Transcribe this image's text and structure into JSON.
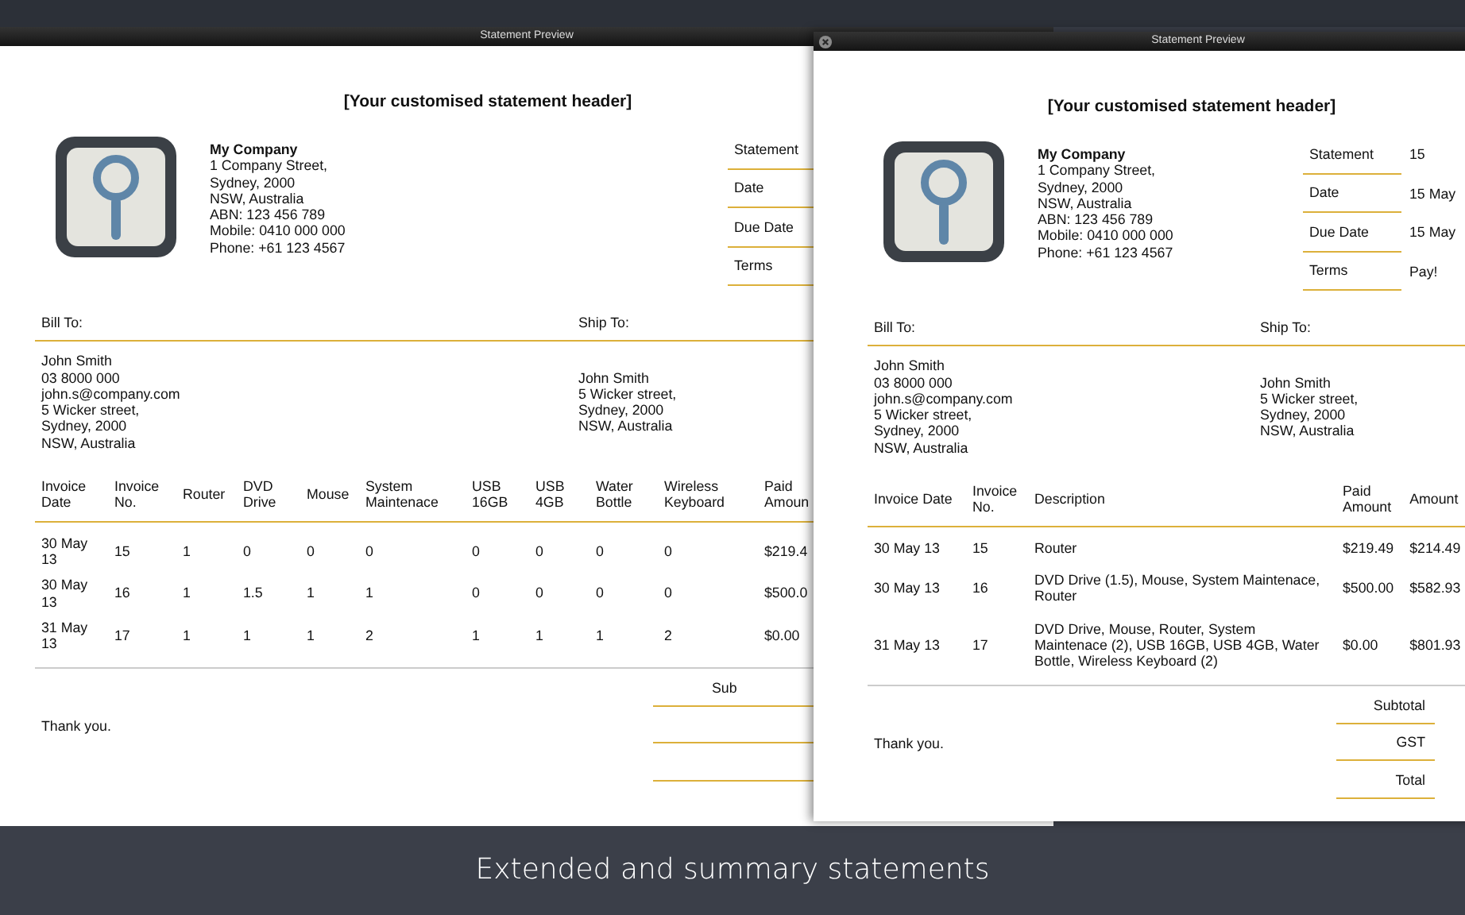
{
  "windows": [
    {
      "kind": "extended",
      "title": "Statement Preview",
      "closable": false,
      "header": "[Your customised statement header]",
      "company": {
        "name": "My Company",
        "lines": [
          "1 Company Street,",
          "Sydney, 2000",
          "NSW, Australia",
          "ABN: 123 456 789",
          "Mobile: 0410 000 000",
          "Phone: +61 123 4567"
        ]
      },
      "meta": [
        {
          "label": "Statement"
        },
        {
          "label": "Date"
        },
        {
          "label": "Due Date"
        },
        {
          "label": "Terms"
        }
      ],
      "bill_to_label": "Bill To:",
      "ship_to_label": "Ship To:",
      "bill_to": [
        "John Smith",
        "03 8000 000",
        "john.s@company.com",
        "5 Wicker street,",
        "Sydney, 2000",
        "NSW, Australia"
      ],
      "ship_to": [
        "John Smith",
        "5 Wicker street,",
        "Sydney, 2000",
        "NSW, Australia"
      ],
      "table": {
        "columns": [
          "Invoice Date",
          "Invoice No.",
          "Router",
          "DVD Drive",
          "Mouse",
          "System Maintenace",
          "USB 16GB",
          "USB 4GB",
          "Water Bottle",
          "Wireless Keyboard",
          "Paid Amoun"
        ],
        "rows": [
          [
            "30 May 13",
            "15",
            "1",
            "0",
            "0",
            "0",
            "0",
            "0",
            "0",
            "0",
            "$219.4"
          ],
          [
            "30 May 13",
            "16",
            "1",
            "1.5",
            "1",
            "1",
            "0",
            "0",
            "0",
            "0",
            "$500.0"
          ],
          [
            "31 May 13",
            "17",
            "1",
            "1",
            "1",
            "2",
            "1",
            "1",
            "1",
            "2",
            "$0.00"
          ]
        ]
      },
      "thank_you": "Thank you.",
      "totals": [
        {
          "label": "Sub",
          "ruled": true
        },
        {
          "ruled": true
        },
        {
          "ruled": true
        }
      ]
    },
    {
      "kind": "summary",
      "title": "Statement Preview",
      "closable": true,
      "header": "[Your customised statement header]",
      "company": {
        "name": "My Company",
        "lines": [
          "1 Company Street,",
          "Sydney, 2000",
          "NSW, Australia",
          "ABN: 123 456 789",
          "Mobile: 0410 000 000",
          "Phone: +61 123 4567"
        ]
      },
      "meta": [
        {
          "label": "Statement",
          "value": "15"
        },
        {
          "label": "Date",
          "value": "15 May"
        },
        {
          "label": "Due Date",
          "value": "15 May"
        },
        {
          "label": "Terms",
          "value": "Pay!"
        }
      ],
      "bill_to_label": "Bill To:",
      "ship_to_label": "Ship To:",
      "bill_to": [
        "John Smith",
        "03 8000 000",
        "john.s@company.com",
        "5 Wicker street,",
        "Sydney, 2000",
        "NSW, Australia"
      ],
      "ship_to": [
        "John Smith",
        "5 Wicker street,",
        "Sydney, 2000",
        "NSW, Australia"
      ],
      "table": {
        "columns": [
          "Invoice Date",
          "Invoice No.",
          "Description",
          "Paid Amount",
          "Amount"
        ],
        "rows": [
          [
            "30 May 13",
            "15",
            "Router",
            "$219.49",
            "$214.49"
          ],
          [
            "30 May 13",
            "16",
            "DVD Drive (1.5), Mouse, System Maintenace, Router",
            "$500.00",
            "$582.93"
          ],
          [
            "31 May 13",
            "17",
            "DVD Drive, Mouse, Router, System Maintenace (2), USB 16GB, USB 4GB, Water Bottle, Wireless Keyboard (2)",
            "$0.00",
            "$801.93"
          ]
        ]
      },
      "thank_you": "Thank you.",
      "totals": [
        {
          "label": "Subtotal",
          "ruled": true
        },
        {
          "label": "GST",
          "ruled": true
        },
        {
          "label": "Total",
          "ruled": true
        }
      ]
    }
  ],
  "caption": "Extended and summary statements"
}
